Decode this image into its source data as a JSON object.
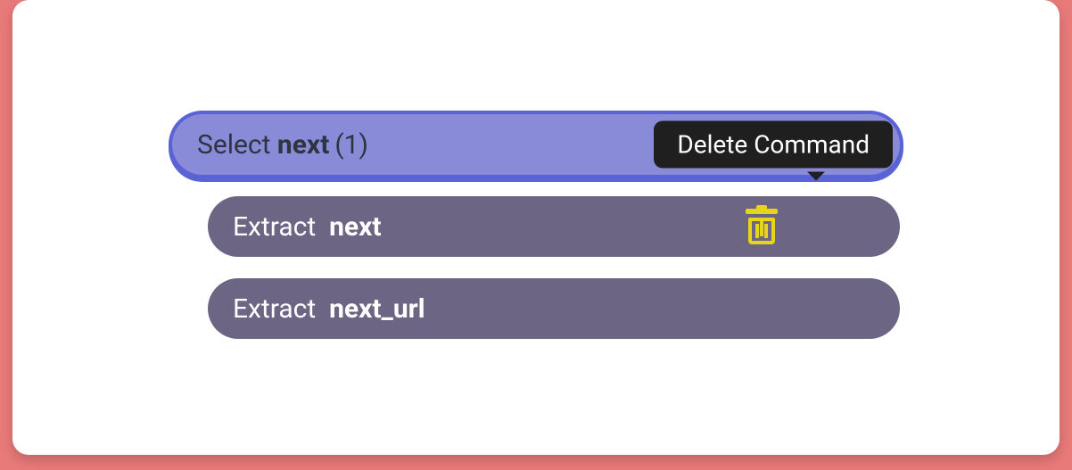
{
  "tooltip": {
    "delete": "Delete Command"
  },
  "commands": [
    {
      "action": "Select",
      "field": "next",
      "suffix": "(1)",
      "selected": true
    },
    {
      "action": "Extract",
      "field": "next",
      "suffix": "",
      "showDelete": true
    },
    {
      "action": "Extract",
      "field": "next_url",
      "suffix": ""
    }
  ]
}
